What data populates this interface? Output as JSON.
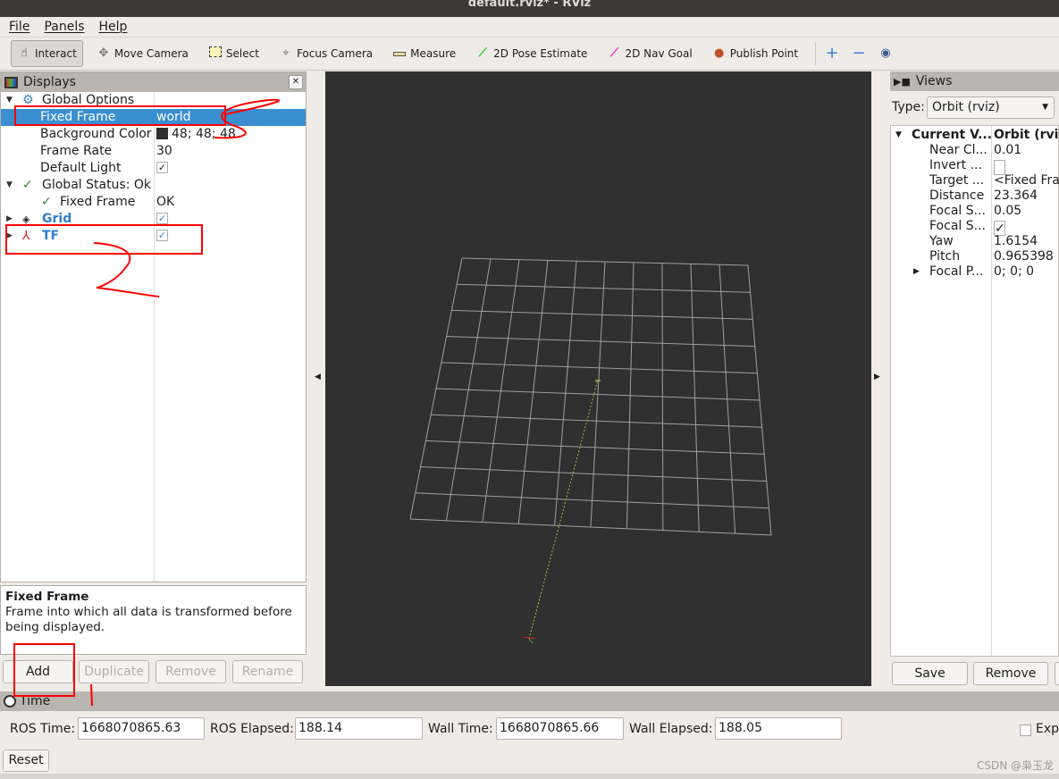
{
  "window": {
    "title": "default.rviz* - RViz"
  },
  "menu": [
    "File",
    "Panels",
    "Help"
  ],
  "toolbar": {
    "tools": [
      {
        "label": "Interact",
        "icon": "hand-icon",
        "active": true
      },
      {
        "label": "Move Camera",
        "icon": "move-camera-icon"
      },
      {
        "label": "Select",
        "icon": "select-icon"
      },
      {
        "label": "Focus Camera",
        "icon": "focus-camera-icon"
      },
      {
        "label": "Measure",
        "icon": "ruler-icon"
      },
      {
        "label": "2D Pose Estimate",
        "icon": "green-arrow-icon"
      },
      {
        "label": "2D Nav Goal",
        "icon": "magenta-arrow-icon"
      },
      {
        "label": "Publish Point",
        "icon": "map-pin-icon"
      }
    ],
    "extra_icons": [
      "plus-icon",
      "minus-icon",
      "eye-icon"
    ]
  },
  "displays": {
    "title": "Displays",
    "global_options": "Global Options",
    "fixed_frame": {
      "label": "Fixed Frame",
      "value": "world"
    },
    "background_color": {
      "label": "Background Color",
      "value": "48; 48; 48",
      "swatch": "#303030"
    },
    "frame_rate": {
      "label": "Frame Rate",
      "value": "30"
    },
    "default_light": {
      "label": "Default Light",
      "checked": true
    },
    "global_status": "Global Status: Ok",
    "status_fixed_frame": {
      "label": "Fixed Frame",
      "value": "OK"
    },
    "grid": {
      "label": "Grid",
      "checked": true
    },
    "tf": {
      "label": "TF",
      "checked": true
    }
  },
  "description": {
    "title": "Fixed Frame",
    "text": "Frame into which all data is transformed before being displayed."
  },
  "display_buttons": {
    "add": "Add",
    "duplicate": "Duplicate",
    "remove": "Remove",
    "rename": "Rename"
  },
  "views": {
    "title": "Views",
    "type_label": "Type:",
    "type_value": "Orbit (rviz)",
    "current_label": "Current V...",
    "current_value": "Orbit (rviz)",
    "props": [
      {
        "k": "Near Cl...",
        "v": "0.01"
      },
      {
        "k": "Invert ...",
        "v": "",
        "checkbox": false
      },
      {
        "k": "Target ...",
        "v": "<Fixed Frame>"
      },
      {
        "k": "Distance",
        "v": "23.364"
      },
      {
        "k": "Focal S...",
        "v": "0.05"
      },
      {
        "k": "Focal S...",
        "v": "",
        "checkbox": true
      },
      {
        "k": "Yaw",
        "v": "1.6154"
      },
      {
        "k": "Pitch",
        "v": "0.965398"
      },
      {
        "k": "Focal P...",
        "v": "0; 0; 0"
      }
    ],
    "save": "Save",
    "remove": "Remove"
  },
  "time": {
    "title": "Time",
    "ros_time_label": "ROS Time:",
    "ros_time": "1668070865.63",
    "ros_elapsed_label": "ROS Elapsed:",
    "ros_elapsed": "188.14",
    "wall_time_label": "Wall Time:",
    "wall_time": "1668070865.66",
    "wall_elapsed_label": "Wall Elapsed:",
    "wall_elapsed": "188.05",
    "experimental": "Exp",
    "reset": "Reset"
  },
  "watermark": "CSDN @枭玉龙",
  "colors": {
    "selection": "#3a8fd0",
    "viewport_bg": "#303030",
    "annotation": "#ff0000"
  }
}
